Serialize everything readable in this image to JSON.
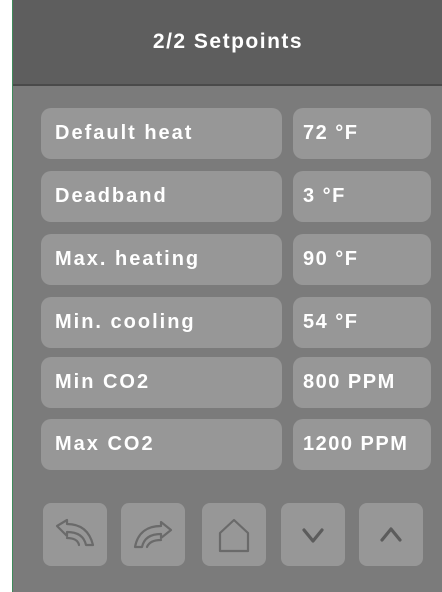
{
  "header": {
    "title": "2/2 Setpoints"
  },
  "setpoints": [
    {
      "label": "Default heat",
      "value": "72 °F"
    },
    {
      "label": "Deadband",
      "value": "3 °F"
    },
    {
      "label": "Max. heating",
      "value": "90 °F"
    },
    {
      "label": "Min. cooling",
      "value": "54 °F"
    },
    {
      "label": "Min CO2",
      "value": "800 PPM"
    },
    {
      "label": "Max CO2",
      "value": "1200 PPM"
    }
  ],
  "nav": {
    "buttons": [
      {
        "icon": "undo-icon"
      },
      {
        "icon": "redo-icon"
      },
      {
        "icon": "home-icon"
      },
      {
        "icon": "chevron-down-icon"
      },
      {
        "icon": "chevron-up-icon"
      }
    ]
  },
  "colors": {
    "screen_bg": "#7b7b7b",
    "header_bg": "#5e5e5e",
    "button_bg": "#979797",
    "text": "#ffffff",
    "icon_stroke": "#6a6a6a"
  }
}
